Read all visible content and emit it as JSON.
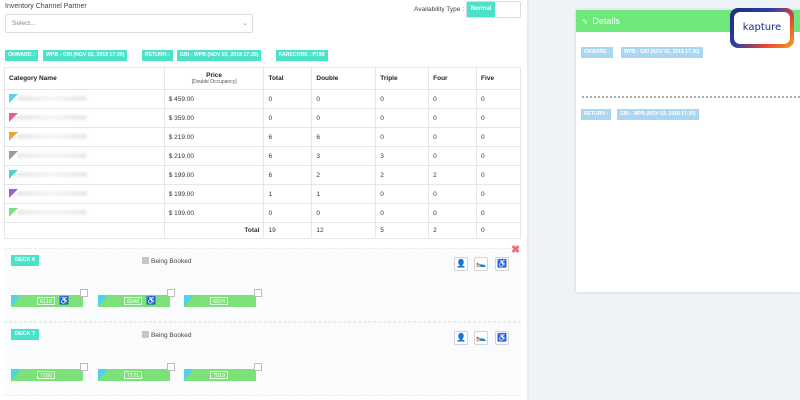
{
  "inventory": {
    "label": "Inventory Channel Partner",
    "select_placeholder": "Select..."
  },
  "availability": {
    "label": "Availability Type :",
    "value": "Normal"
  },
  "tags": {
    "onward_label": "ONWARD :",
    "onward_value": "WPB - GBI (NOV 02, 2018 17:30)",
    "return_label": "RETURN :",
    "return_value": "GBI - WPB (NOV 03, 2018 17:30)",
    "farecode": "FARECODE : P199"
  },
  "table": {
    "headers": {
      "category": "Category Name",
      "price": "Price",
      "price_sub": "[Double Occupancy]",
      "total": "Total",
      "double": "Double",
      "triple": "Triple",
      "four": "Four",
      "five": "Five"
    },
    "rows": [
      {
        "color": "#5ad1e8",
        "price": "$ 459.00",
        "total": "0",
        "double": "0",
        "triple": "0",
        "four": "0",
        "five": "0"
      },
      {
        "color": "#ef5b84",
        "price": "$ 359.00",
        "total": "0",
        "double": "0",
        "triple": "0",
        "four": "0",
        "five": "0"
      },
      {
        "color": "#f2a040",
        "price": "$ 219.00",
        "total": "6",
        "double": "6",
        "triple": "0",
        "four": "0",
        "five": "0"
      },
      {
        "color": "#9a9a9a",
        "price": "$ 219.00",
        "total": "6",
        "double": "3",
        "triple": "3",
        "four": "0",
        "five": "0"
      },
      {
        "color": "#46d6c6",
        "price": "$ 199.00",
        "total": "6",
        "double": "2",
        "triple": "2",
        "four": "2",
        "five": "0"
      },
      {
        "color": "#9b5de5",
        "price": "$ 199.00",
        "total": "1",
        "double": "1",
        "triple": "0",
        "four": "0",
        "five": "0"
      },
      {
        "color": "#7de17a",
        "price": "$ 199.00",
        "total": "0",
        "double": "0",
        "triple": "0",
        "four": "0",
        "five": "0"
      }
    ],
    "totals": {
      "label": "Total",
      "total": "19",
      "double": "12",
      "triple": "5",
      "four": "2",
      "five": "0"
    }
  },
  "decks": [
    {
      "name": "DECK 6",
      "legend": "Being Booked",
      "cabins": [
        {
          "number": "6110",
          "accessible": true
        },
        {
          "number": "6048",
          "accessible": true
        },
        {
          "number": "6024",
          "accessible": false
        }
      ]
    },
    {
      "name": "DECK 7",
      "legend": "Being Booked",
      "cabins": [
        {
          "number": "7160",
          "accessible": false
        },
        {
          "number": "7171",
          "accessible": false
        },
        {
          "number": "7019",
          "accessible": false
        }
      ]
    }
  ],
  "icons": {
    "person": "person-icon",
    "bed": "bed-icon",
    "wheelchair": "wheelchair-icon",
    "close": "close-icon"
  },
  "details": {
    "title": "Details",
    "onward_label": "ONWARD :",
    "onward_value": "WPB - GBI (NOV 02, 2018 17:30)",
    "return_label": "RETURN :",
    "return_value": "GBI - WPB (NOV 03, 2018 17:30)"
  },
  "logo": {
    "text": "kapture"
  },
  "colors": {
    "accent": "#4be3c8",
    "details_header": "#6ee87a",
    "cabin": "#7de17a",
    "close": "#ef6a7d"
  }
}
